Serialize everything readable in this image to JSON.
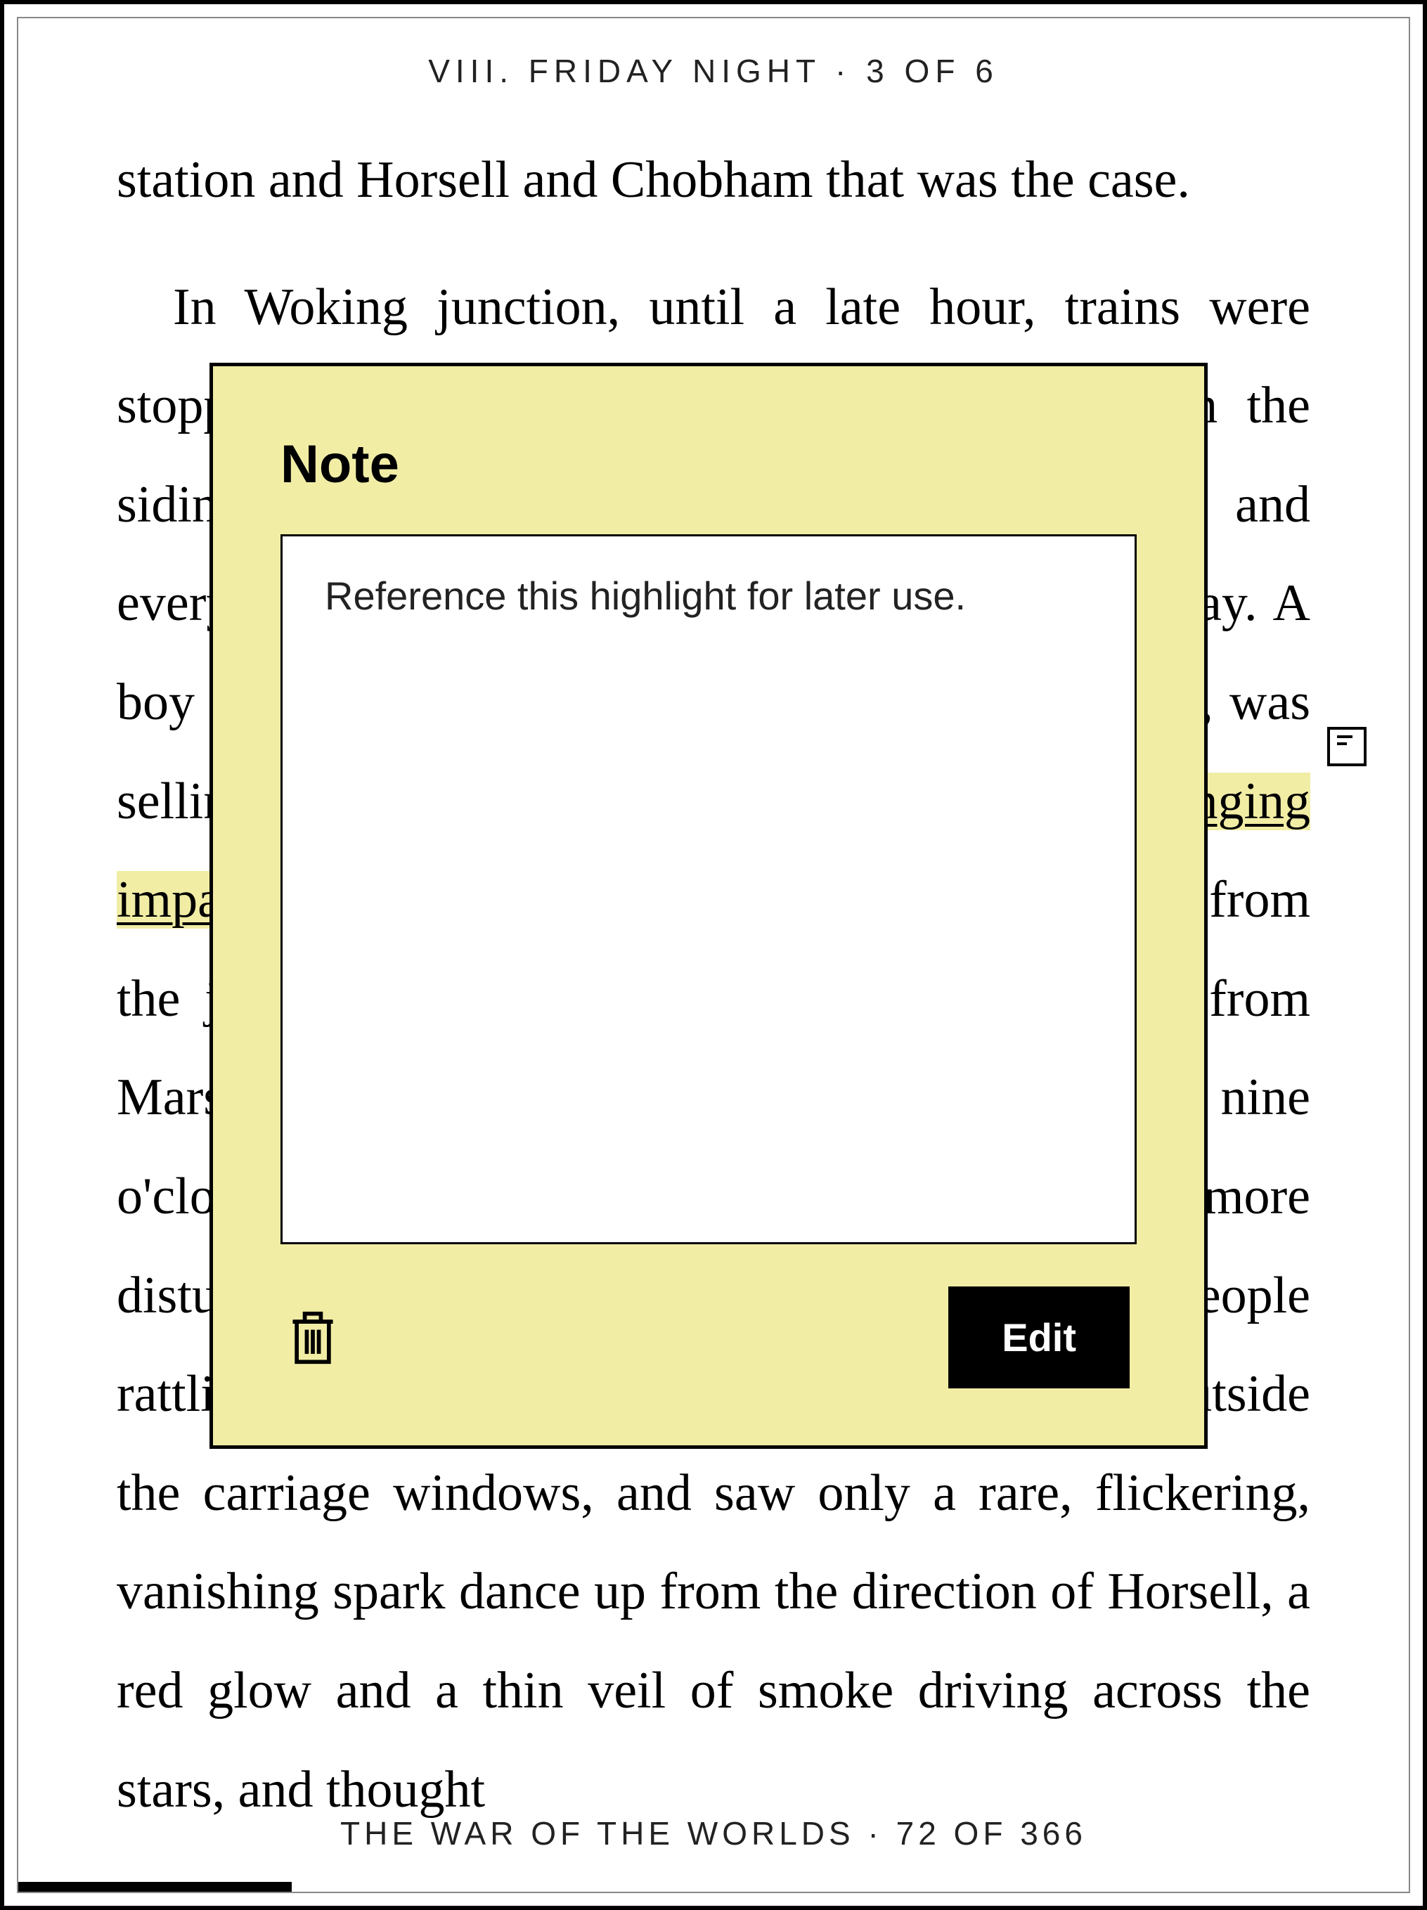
{
  "header": {
    "chapter": "VIII. FRIDAY NIGHT",
    "separator": " · ",
    "page_in_chapter": "3 OF 6"
  },
  "body": {
    "para1": "station and Horsell and Chobham that was the case.",
    "para2_pre": "In Woking junction, until a late hour, trains were stopping and going on, others were shunting on the sidings, passengers were alighting and waiting, and everything was proceeding in the most ordinary way. A boy from the town, trenching on Smith's monopoly, was selling papers with ",
    "para2_hl": "the afternoon's news. The ringing impact of trucks, the sym",
    "para2_post": "p whistle of the engines from the junction, mingled with their shouts of \"Men from Mars!\" Excited men came into the station about nine o'clock with incredible tidings, and caused no more disturbance than drunkards might have done. People rattling Londonwards peered into the darkness outside the carriage windows, and saw only a rare, flickering, vanishing spark dance up from the direction of Horsell, a red glow and a thin veil of smoke driving across the stars, and thought"
  },
  "note": {
    "title": "Note",
    "content": "Reference this highlight for later use.",
    "edit_label": "Edit"
  },
  "footer": {
    "book_title": "THE WAR OF THE WORLDS",
    "separator": " · ",
    "page_in_book": "72 OF 366"
  },
  "progress": {
    "current": 72,
    "total": 366
  }
}
